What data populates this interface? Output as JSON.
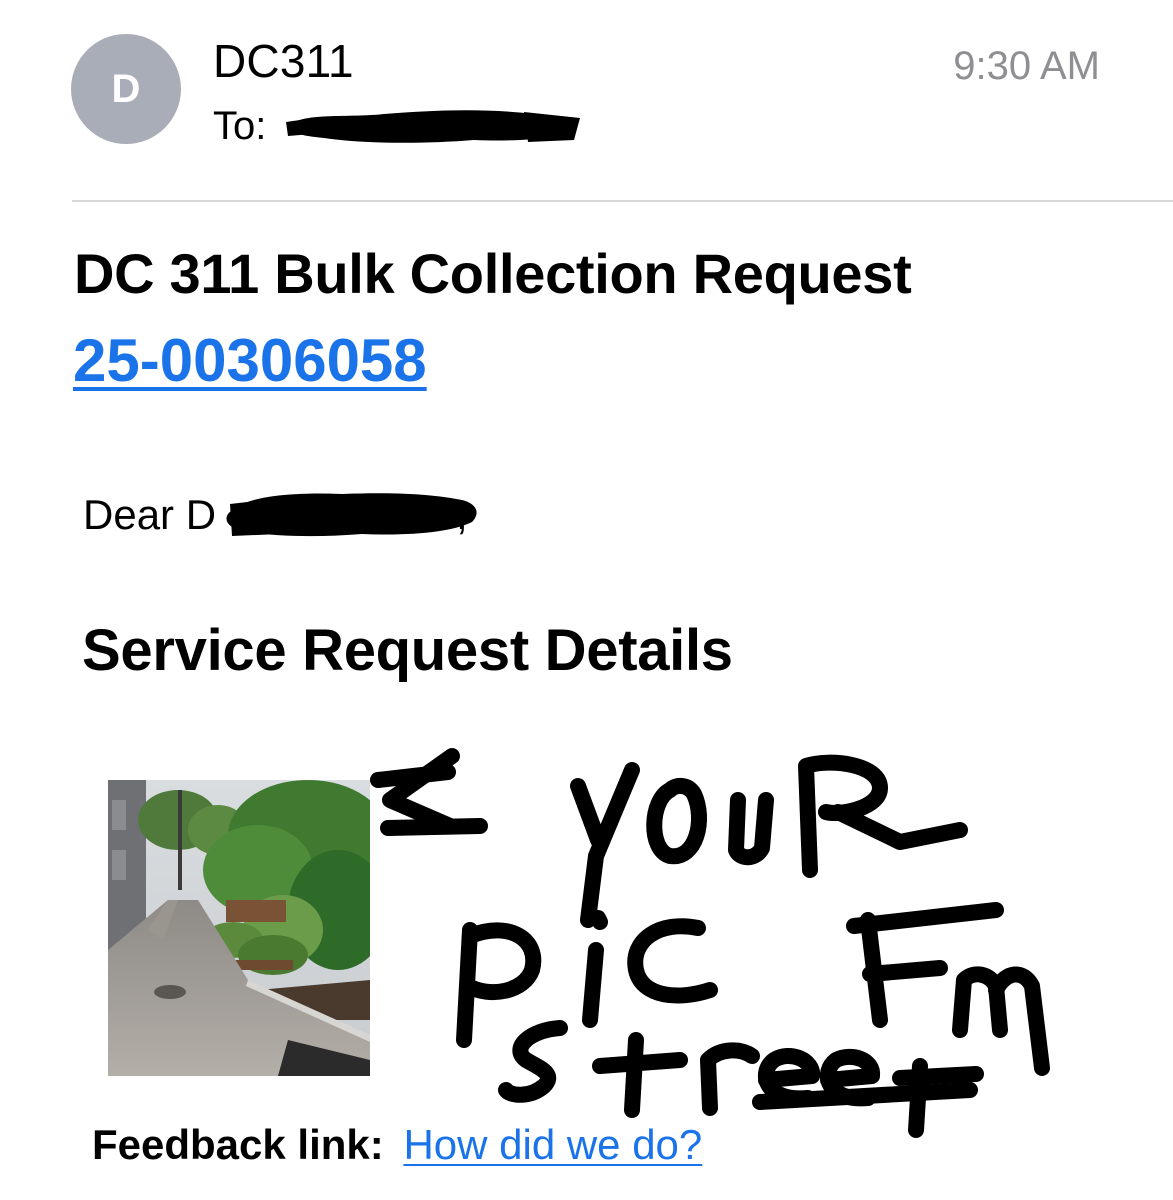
{
  "header": {
    "avatar_initial": "D",
    "sender": "DC311",
    "to_label": "To:",
    "time": "9:30 AM"
  },
  "email": {
    "subject": "DC 311 Bulk Collection Request",
    "request_number": "25-00306058",
    "greeting": "Dear D",
    "greeting_suffix": ",",
    "section_heading": "Service Request Details",
    "feedback_label": "Feedback link:",
    "feedback_link": "How did we do?"
  },
  "colors": {
    "link": "#1a73e8",
    "avatar_bg": "#a9adb7",
    "time_text": "#8e8e93",
    "divider": "#d6d6d8"
  },
  "icons": {
    "avatar": "avatar-circle",
    "redaction": "redaction-marker",
    "photo": "street-alley-photo"
  }
}
